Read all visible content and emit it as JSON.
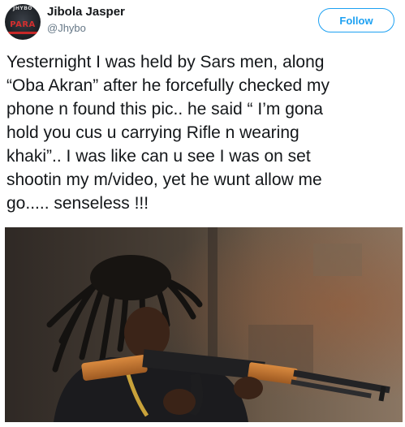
{
  "user": {
    "name": "Jibola Jasper",
    "handle": "@Jhybo",
    "avatar_watermark": "JHYBO",
    "avatar_logo": "PARA"
  },
  "actions": {
    "follow_label": "Follow"
  },
  "tweet": {
    "text": "Yesternight I was held by Sars men, along\n“Oba Akran” after he forcefully checked my\nphone n found this pic.. he said “ I’m gona\nhold you cus u carrying Rifle  n wearing\nkhaki”.. I was like can u see I was on set\nshootin my m/video, yet he wunt allow me\ngo..... senseless !!!"
  },
  "colors": {
    "accent": "#1da1f2",
    "text": "#14171a",
    "secondary_text": "#657786"
  },
  "icons": {
    "avatar": "profile-avatar-para-logo",
    "photo": "man-with-dreadlocks-holding-rifle"
  }
}
